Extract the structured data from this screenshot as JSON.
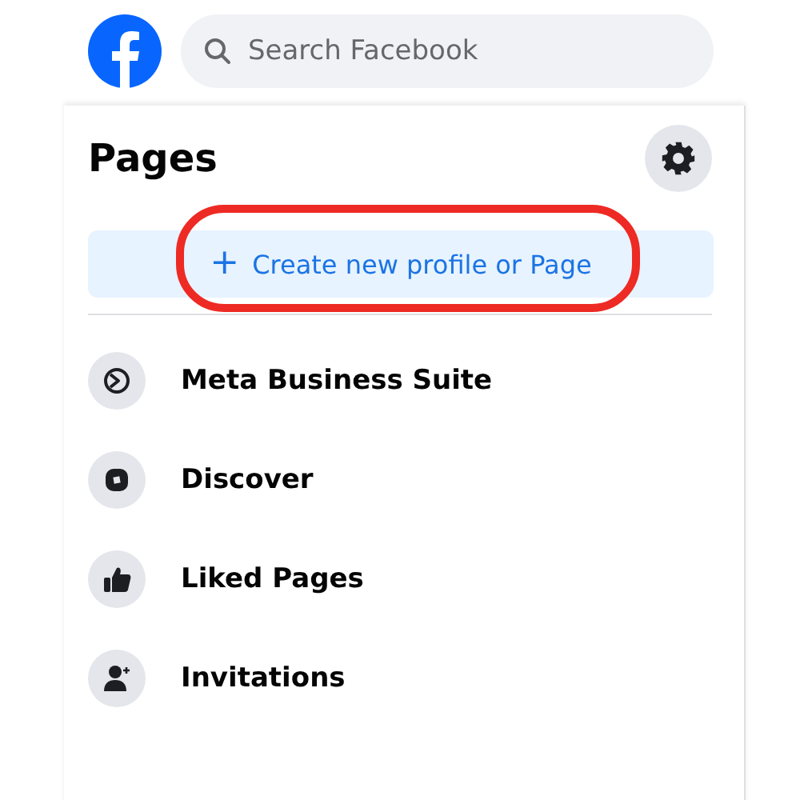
{
  "search": {
    "placeholder": "Search Facebook"
  },
  "panel": {
    "title": "Pages",
    "create_button": {
      "label": "Create new profile or Page",
      "icon": "+",
      "highlighted": true
    }
  },
  "items": [
    {
      "kind": "business",
      "label": "Meta Business Suite"
    },
    {
      "kind": "discover",
      "label": "Discover"
    },
    {
      "kind": "liked",
      "label": "Liked Pages"
    },
    {
      "kind": "invitations",
      "label": "Invitations"
    }
  ]
}
